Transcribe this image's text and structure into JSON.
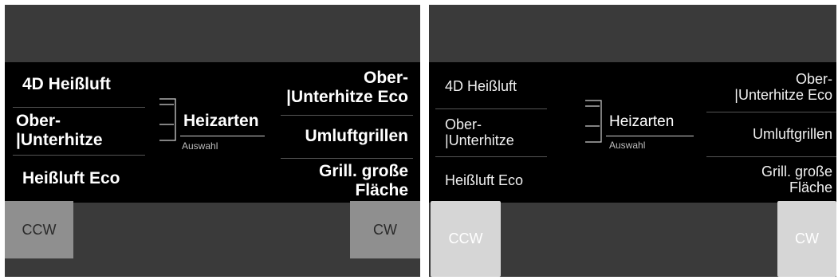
{
  "left": {
    "menu_left": [
      "4D Heißluft",
      "Ober-\n|Unterhitze",
      "Heißluft Eco"
    ],
    "menu_right": [
      "Ober-\n|Unterhitze Eco",
      "Umluftgrillen",
      "Grill. große\nFläche"
    ],
    "center_title": "Heizarten",
    "center_sub": "Auswahl",
    "ccw_label": "CCW",
    "cw_label": "CW"
  },
  "right": {
    "menu_left": [
      "4D Heißluft",
      "Ober-\n|Unterhitze",
      "Heißluft Eco"
    ],
    "menu_right": [
      "Ober-\n|Unterhitze Eco",
      "Umluftgrillen",
      "Grill. große\nFläche"
    ],
    "center_title": "Heizarten",
    "center_sub": "Auswahl",
    "ccw_label": "CCW",
    "cw_label": "CW"
  },
  "colors": {
    "screen_bg": "#3a3a3a",
    "menu_bg": "#000000",
    "left_button_bg": "#8f8f8f",
    "right_button_bg": "#d6d6d6"
  }
}
